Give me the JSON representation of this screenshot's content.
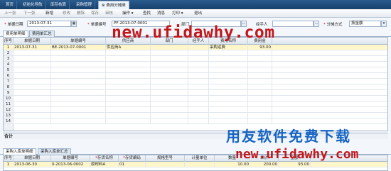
{
  "tabs": [
    {
      "label": "首页"
    },
    {
      "label": "初始化导航"
    },
    {
      "label": "库存核算"
    },
    {
      "label": "采购管理"
    },
    {
      "label": "费用分摊单"
    }
  ],
  "toolbar": {
    "items": [
      "上一张",
      "下一张",
      "新增",
      "修改",
      "删除",
      "保存",
      "审核",
      "操作",
      "查找",
      "消息",
      "打印",
      "退出"
    ]
  },
  "form": {
    "date_label": "单据日期",
    "date_value": "2013-07-31",
    "docno_label": "单据编号",
    "docno_value": "PF-2013-07-0001",
    "dept_label": "部门",
    "dept_value": "",
    "handler_label": "经手人",
    "handler_value": "",
    "alloc_label": "分摊方式",
    "alloc_value": "按金额"
  },
  "subtabs": [
    "费用单明细",
    "费用单汇总"
  ],
  "grid": {
    "headers": [
      "序号",
      "单据日期",
      "单据编号",
      "供应商",
      "部门",
      "经手人",
      "费用名称",
      "费用金"
    ],
    "rows": [
      {
        "no": "1",
        "date": "2013-07-31",
        "docno": "BE-2013-07-0001",
        "supplier": "供应商A",
        "dept": "",
        "handler": "",
        "fee_name": "采购运费",
        "amount": "93.00"
      },
      {
        "no": "2"
      },
      {
        "no": "3"
      },
      {
        "no": "4"
      },
      {
        "no": "5"
      },
      {
        "no": "6"
      },
      {
        "no": "7"
      },
      {
        "no": "8"
      },
      {
        "no": "9"
      },
      {
        "no": "10"
      },
      {
        "no": "11"
      },
      {
        "no": "12"
      },
      {
        "no": "13"
      },
      {
        "no": "14"
      }
    ]
  },
  "sum_label": "合计",
  "bottom_tabs": [
    "采购入库单明细",
    "采购入库单汇总"
  ],
  "bgrid": {
    "headers": [
      "序号",
      "单据日期",
      "单据编号",
      "存货名称",
      "存货编码",
      "规格型号",
      "计量单位",
      "数量",
      "单价",
      "金额"
    ],
    "rows": [
      {
        "no": "1",
        "date": "2013-06-30",
        "docno": "II-2013-06-0002",
        "item": "原材料A",
        "code": "01",
        "spec": "",
        "unit": "",
        "qty": "10.00",
        "price": "200.00",
        "amount": "93.00"
      }
    ]
  },
  "watermarks": {
    "url_top": "new.ufidawhy.com",
    "slogan": "用友软件免费下载",
    "url_bottom": "new.ufidawhy.com"
  },
  "colors": {
    "tab_bar": "#1f4c7d",
    "selected_row": "#fff7c9",
    "watermark_red": "#c2171b",
    "watermark_blue": "#1664c4"
  }
}
